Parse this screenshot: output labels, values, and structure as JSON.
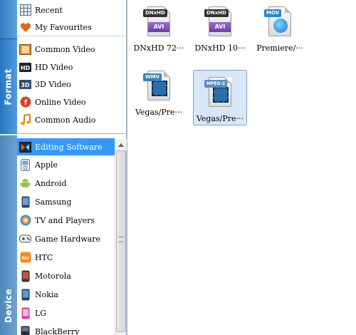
{
  "tabs": {
    "format_label": "Format",
    "device_label": "Device"
  },
  "format_list": [
    {
      "label": "Recent",
      "icon": "recent-grid-icon"
    },
    {
      "label": "My Favourites",
      "icon": "heart-icon"
    },
    {
      "label": "Common Video",
      "icon": "film-icon"
    },
    {
      "label": "HD Video",
      "icon": "hd-icon"
    },
    {
      "label": "3D Video",
      "icon": "3d-icon"
    },
    {
      "label": "Online Video",
      "icon": "online-f-icon"
    },
    {
      "label": "Common Audio",
      "icon": "music-note-icon"
    }
  ],
  "device_list": [
    {
      "label": "Editing Software",
      "icon": "editing-software-icon",
      "selected": true
    },
    {
      "label": "Apple",
      "icon": "ipod-icon"
    },
    {
      "label": "Android",
      "icon": "android-icon"
    },
    {
      "label": "Samsung",
      "icon": "phone-icon"
    },
    {
      "label": "TV and Players",
      "icon": "tv-player-icon"
    },
    {
      "label": "Game Hardware",
      "icon": "gamepad-icon"
    },
    {
      "label": "HTC",
      "icon": "htc-icon"
    },
    {
      "label": "Motorola",
      "icon": "motorola-phone-icon"
    },
    {
      "label": "Nokia",
      "icon": "nokia-phone-icon"
    },
    {
      "label": "LG",
      "icon": "lg-phone-icon"
    },
    {
      "label": "BlackBerry",
      "icon": "blackberry-icon"
    }
  ],
  "formats_grid": [
    {
      "caption": "DNxHD 72···",
      "badge": "DNxHD",
      "kind": "avi",
      "strip": "AVI"
    },
    {
      "caption": "DNxHD 10···",
      "badge": "DNxHD",
      "kind": "avi",
      "strip": "AVI"
    },
    {
      "caption": "Premiere/···",
      "badge": "MOV",
      "kind": "mov"
    },
    {
      "caption": "Vegas/Pre···",
      "badge": "WMV",
      "kind": "film"
    },
    {
      "caption": "Vegas/Pre···",
      "badge": "MPEG-2",
      "kind": "film",
      "selected": true
    }
  ],
  "colors": {
    "selection": "#3399ff",
    "tab_blue": "#2876bd",
    "badge_dnxhd": "#333333",
    "badge_mov": "#2a86d1",
    "badge_wmv": "#3d7dbd",
    "badge_mpeg": "#5b8ec2"
  }
}
